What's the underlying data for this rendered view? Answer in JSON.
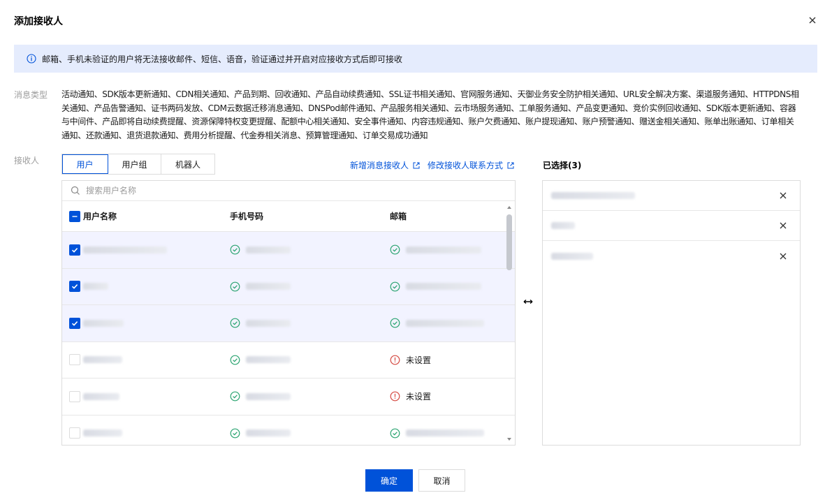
{
  "dialog": {
    "title": "添加接收人",
    "info": "邮箱、手机未验证的用户将无法接收邮件、短信、语音，验证通过并开启对应接收方式后即可接收"
  },
  "message_types": {
    "label": "消息类型",
    "text": "活动通知、SDK版本更新通知、CDN相关通知、产品到期、回收通知、产品自动续费通知、SSL证书相关通知、官网服务通知、天御业务安全防护相关通知、URL安全解决方案、渠道服务通知、HTTPDNS相关通知、产品告警通知、证书两码发放、CDM云数据迁移消息通知、DNSPod邮件通知、产品服务相关通知、云市场服务通知、工单服务通知、产品变更通知、竞价实例回收通知、SDK版本更新通知、容器与中间件、产品即将自动续费提醒、资源保障特权变更提醒、配额中心相关通知、安全事件通知、内容违规通知、账户欠费通知、账户提现通知、账户预警通知、赠送金相关通知、账单出账通知、订单相关通知、还款通知、退货退款通知、费用分析提醒、代金券相关消息、预算管理通知、订单交易成功通知"
  },
  "recipients": {
    "label": "接收人",
    "tabs": [
      {
        "label": "用户",
        "active": true
      },
      {
        "label": "用户组",
        "active": false
      },
      {
        "label": "机器人",
        "active": false
      }
    ],
    "links": {
      "add": "新增消息接收人",
      "modify": "修改接收人联系方式"
    },
    "search": {
      "placeholder": "搜索用户名称"
    },
    "columns": {
      "name": "用户名称",
      "phone": "手机号码",
      "email": "邮箱"
    },
    "rows": [
      {
        "checked": true,
        "phone_status": "verified",
        "email_status": "verified",
        "email_text": ""
      },
      {
        "checked": true,
        "phone_status": "verified",
        "email_status": "verified",
        "email_text": ""
      },
      {
        "checked": true,
        "phone_status": "verified",
        "email_status": "verified",
        "email_text": ""
      },
      {
        "checked": false,
        "phone_status": "verified",
        "email_status": "unset",
        "email_text": "未设置"
      },
      {
        "checked": false,
        "phone_status": "verified",
        "email_status": "unset",
        "email_text": "未设置"
      },
      {
        "checked": false,
        "phone_status": "verified",
        "email_status": "verified",
        "email_text": ""
      }
    ]
  },
  "selected": {
    "title": "已选择(3)",
    "count": 3
  },
  "footer": {
    "confirm": "确定",
    "cancel": "取消"
  },
  "colors": {
    "primary": "#0052d9",
    "success": "#2ba471",
    "warning": "#d54941",
    "info_bg": "#e5ecfd"
  }
}
